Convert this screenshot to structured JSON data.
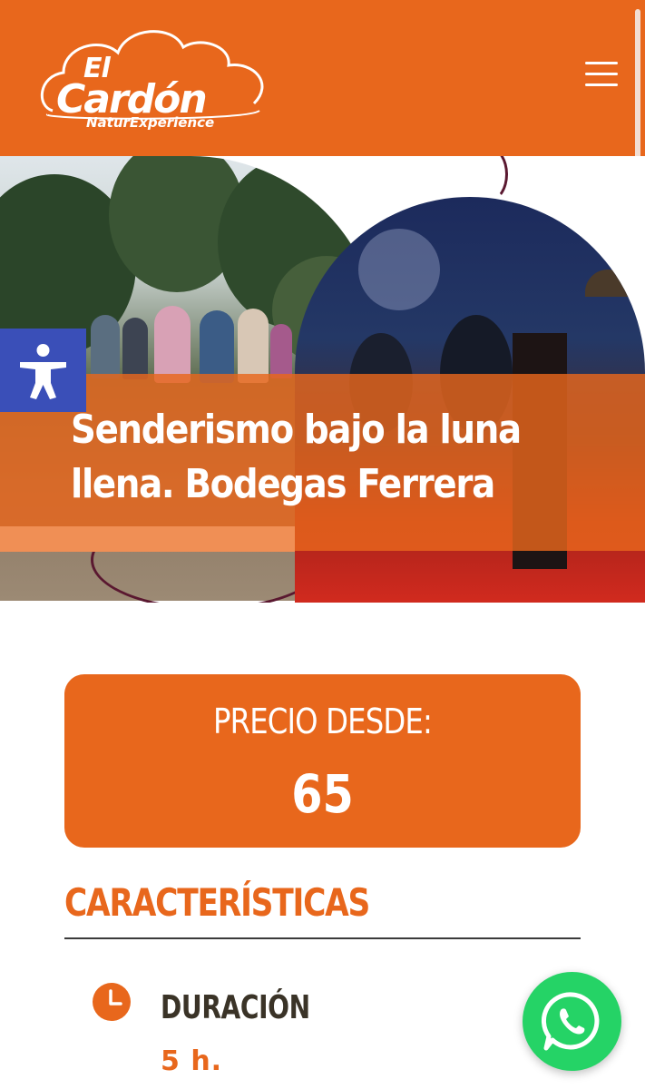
{
  "header": {
    "logo": {
      "line1": "El",
      "line2": "Cardón",
      "tagline": "NaturExperience"
    },
    "menu_icon": "hamburger-menu-icon"
  },
  "hero": {
    "title": "Senderismo bajo la luna llena. Bodegas Ferrera",
    "accessibility_icon": "accessibility-person-icon"
  },
  "price": {
    "label": "PRECIO DESDE:",
    "value": "65"
  },
  "characteristics": {
    "title": "CARACTERÍSTICAS",
    "items": [
      {
        "icon": "clock-icon",
        "label": "DURACIÓN",
        "value": "5 h."
      }
    ]
  },
  "floating": {
    "whatsapp_icon": "whatsapp-icon"
  },
  "colors": {
    "brand_orange": "#e8671c",
    "accessibility_blue": "#3a4fb8",
    "whatsapp_green": "#25d366"
  }
}
